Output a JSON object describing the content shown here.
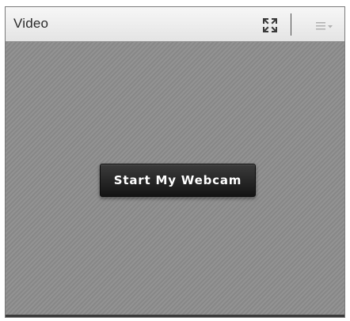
{
  "pod": {
    "title": "Video",
    "header_icons": [
      "fullscreen-icon",
      "options-menu-icon"
    ]
  },
  "video": {
    "start_button_label": "Start My Webcam"
  },
  "colors": {
    "header_bg": "#ececec",
    "video_bg": "#8d8d8d",
    "button_bg": "#1f1f1f",
    "button_text": "#ffffff"
  }
}
